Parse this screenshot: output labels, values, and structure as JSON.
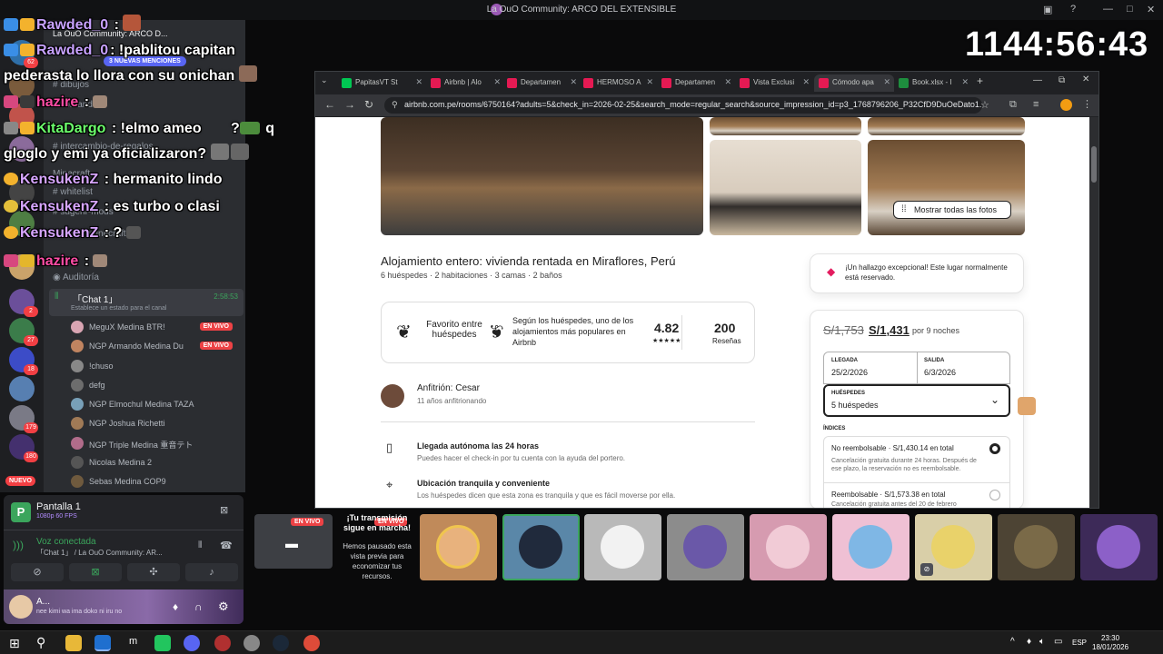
{
  "window": {
    "title": "La OuO Community: ARCO DEL EXTENSIBLE"
  },
  "timer": "1144:56:43",
  "chat": [
    {
      "user": "Rawded_0",
      "user_color": "#c8a2ff",
      "text": ":"
    },
    {
      "user": "Rawded_0",
      "user_color": "#c8a2ff",
      "text": ": !pablitou capitan"
    },
    {
      "user": "",
      "user_color": "#ffffff",
      "text": "pederasta lo llora con su onichan"
    },
    {
      "user": "hazire",
      "user_color": "#ff4da6",
      "text": ":"
    },
    {
      "user": "KitaDargo",
      "user_color": "#6cff6c",
      "text": ": !elmo ameo"
    },
    {
      "user": "",
      "user_color": "#ffffff",
      "text": "gloglo y emi ya oficializaron?"
    },
    {
      "user": "KensukenZ",
      "user_color": "#d7a6ff",
      "text": ": hermanito lindo"
    },
    {
      "user": "KensukenZ",
      "user_color": "#d7a6ff",
      "text": ": es turbo o clasi"
    },
    {
      "user": "KensukenZ",
      "user_color": "#d7a6ff",
      "text": ": ?"
    },
    {
      "user": "hazire",
      "user_color": "#ff4da6",
      "text": ":"
    }
  ],
  "chat_extra": {
    "q": "q"
  },
  "discord": {
    "server_name": "La OuO Community: ARCO D...",
    "mentions": "3 NUEVAS MENCIONES",
    "channels": [
      "dibujos",
      "comandos",
      "intercambio-de-regalos",
      "Minecraft",
      "whitelist",
      "sugerir-mods",
      "server-minecraft",
      "Auditoría"
    ],
    "voice_channel": {
      "name": "「Chat 1」",
      "time": "2:58:53",
      "status": "Establece un estado para el canal"
    },
    "members": [
      {
        "name": "MeguX Medina",
        "tag": "BTR!",
        "live": true
      },
      {
        "name": "NGP Armando Medina",
        "tag": "Du",
        "live": true
      },
      {
        "name": "!chuso",
        "tag": "",
        "live": false
      },
      {
        "name": "defg",
        "tag": "",
        "live": false
      },
      {
        "name": "NGP Elmochul Medina",
        "tag": "TAZA",
        "live": false
      },
      {
        "name": "NGP Joshua Richetti",
        "tag": "",
        "live": false
      },
      {
        "name": "NGP Triple Medina",
        "tag": "重音テト",
        "live": false
      },
      {
        "name": "Nicolas Medina 2",
        "tag": "",
        "live": false
      },
      {
        "name": "Sebas Medina",
        "tag": "COP9",
        "live": false
      }
    ],
    "live_label": "EN VIVO",
    "rail_badges": [
      "62",
      "2",
      "27",
      "18",
      "179",
      "180"
    ],
    "new_label": "NUEVO",
    "screen_share": {
      "title": "Pantalla 1",
      "quality": "1080p 60 FPS"
    },
    "voice_status": {
      "title": "Voz conectada",
      "channel": "「Chat 1」 / La OuO Community: AR..."
    },
    "user": {
      "name": "A...",
      "status": "nee kimi wa ima doko ni iru no"
    }
  },
  "browser": {
    "tabs": [
      "PapitasVT St",
      "Airbnb | Alo",
      "Departamen",
      "HERMOSO A",
      "Departamen",
      "Vista Exclusi",
      "Cómodo apa",
      "Book.xlsx - I"
    ],
    "active_tab": 6,
    "url": "airbnb.com.pe/rooms/6750164?adults=5&check_in=2026-02-25&search_mode=regular_search&source_impression_id=p3_1768796206_P32CfD9DuOeDato1..."
  },
  "listing": {
    "show_photos": "Mostrar todas las fotos",
    "title": "Alojamiento entero: vivienda rentada en Miraflores, Perú",
    "subtitle": "6 huéspedes · 2 habitaciones · 3 camas · 2 baños",
    "favorite_label": "Favorito entre huéspedes",
    "favorite_desc": "Según los huéspedes, uno de los alojamientos más populares en Airbnb",
    "rating": "4.82",
    "stars": "★★★★★",
    "reviews_count": "200",
    "reviews_label": "Reseñas",
    "host_title": "Anfitrión: Cesar",
    "host_sub": "11 años anfitrionando",
    "features": [
      {
        "title": "Llegada autónoma las 24 horas",
        "desc": "Puedes hacer el check-in por tu cuenta con la ayuda del portero."
      },
      {
        "title": "Ubicación tranquila y conveniente",
        "desc": "Los huéspedes dicen que esta zona es tranquila y que es fácil moverse por ella."
      }
    ],
    "rare_find": "¡Un hallazgo excepcional! Este lugar normalmente está reservado.",
    "old_price": "S/1,753",
    "price": "S/1,431",
    "price_nights": "por 9 noches",
    "checkin_label": "LLEGADA",
    "checkin_value": "25/2/2026",
    "checkout_label": "SALIDA",
    "checkout_value": "6/3/2026",
    "guests_label": "HUÉSPEDES",
    "guests_value": "5 huéspedes",
    "prices_label": "ÍNDICES",
    "option1_title": "No reembolsable · S/1,430.14 en total",
    "option1_desc": "Cancelación gratuita durante 24 horas. Después de ese plazo, la reservación no es reembolsable.",
    "option2_title": "Reembolsable · S/1,573.38 en total",
    "option2_desc": "Cancelación gratuita antes del 20 de febrero"
  },
  "stream_row": {
    "live_label": "EN VIVO",
    "paused_title": "¡Tu transmisión sigue en marcha!",
    "paused_desc": "Hemos pausado esta vista previa para economizar tus recursos."
  },
  "taskbar": {
    "time": "23:30",
    "date": "18/01/2026",
    "lang": "ESP"
  }
}
